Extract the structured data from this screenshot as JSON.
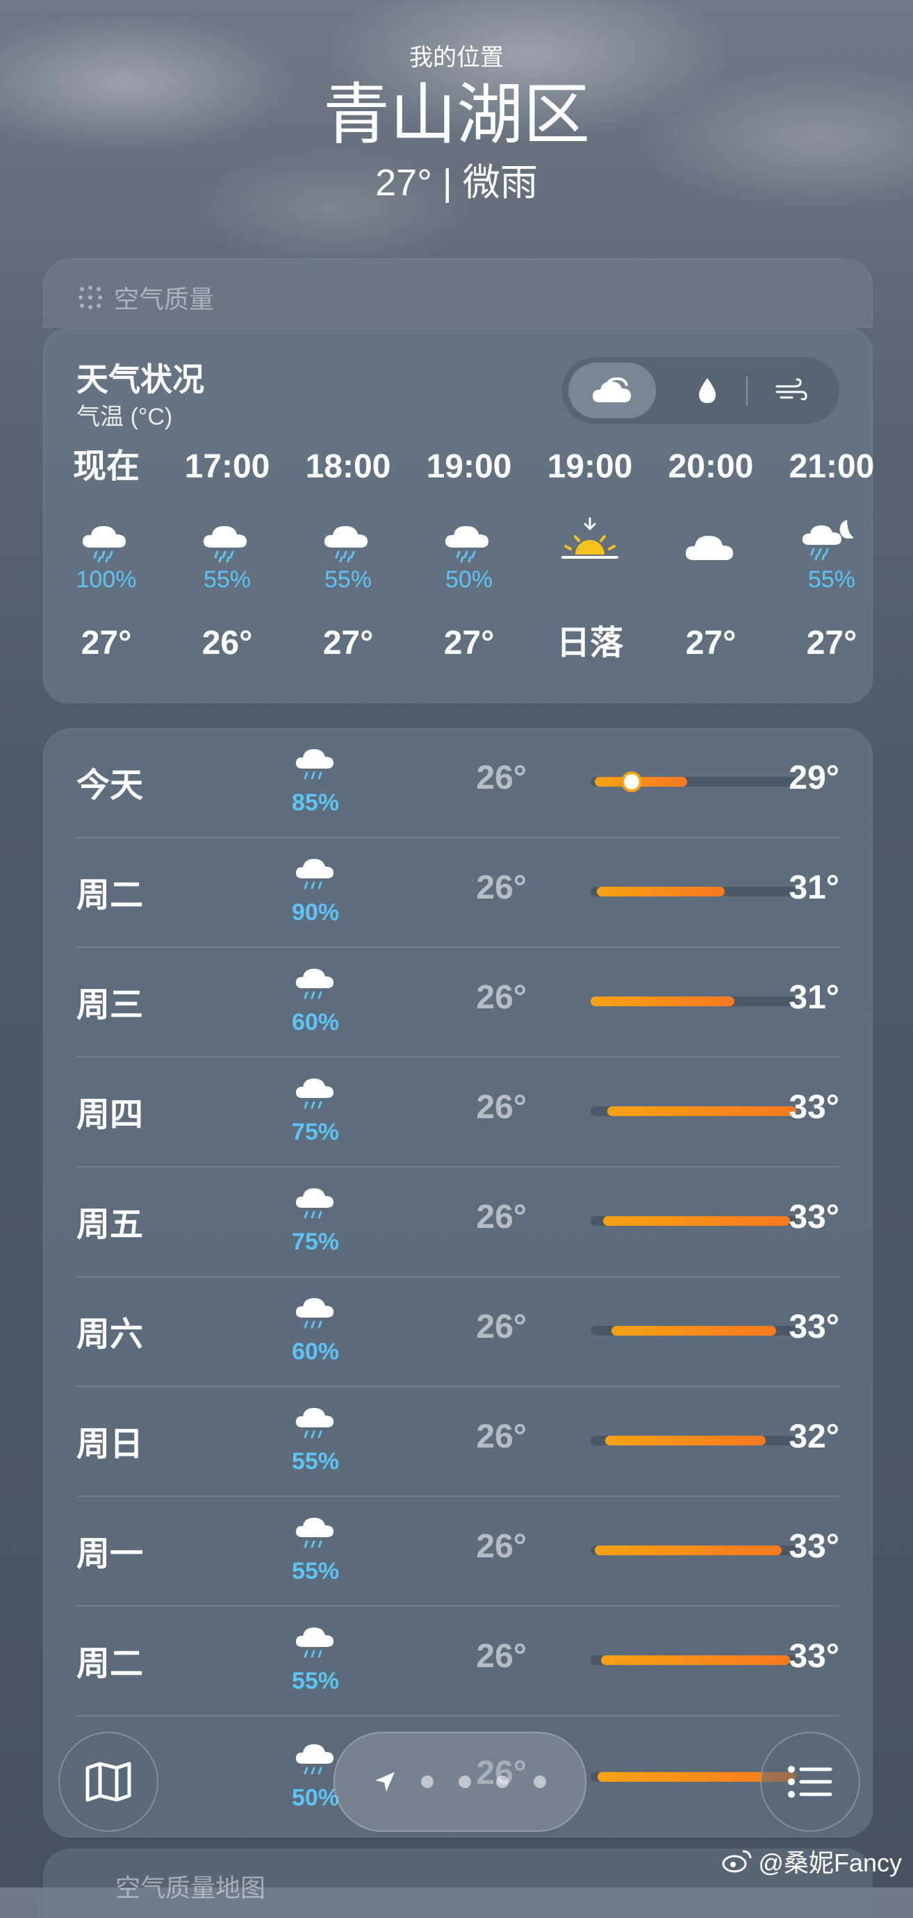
{
  "header": {
    "location_label": "我的位置",
    "city": "青山湖区",
    "summary": "27° | 微雨"
  },
  "aqi": {
    "label": "空气质量"
  },
  "hourly": {
    "title": "天气状况",
    "subtitle": "气温 (°C)",
    "tabs": [
      "cloud-icon",
      "raindrop-icon",
      "wind-icon"
    ],
    "items": [
      {
        "time": "现在",
        "icon": "cloud-rain-icon",
        "pct": "100%",
        "temp": "27°"
      },
      {
        "time": "17:00",
        "icon": "cloud-rain-icon",
        "pct": "55%",
        "temp": "26°"
      },
      {
        "time": "18:00",
        "icon": "cloud-rain-icon",
        "pct": "55%",
        "temp": "27°"
      },
      {
        "time": "19:00",
        "icon": "cloud-rain-icon",
        "pct": "50%",
        "temp": "27°"
      },
      {
        "time": "19:00",
        "icon": "sunset-icon",
        "pct": "",
        "temp": "日落"
      },
      {
        "time": "20:00",
        "icon": "cloud-icon",
        "pct": "",
        "temp": "27°"
      },
      {
        "time": "21:00",
        "icon": "cloud-moon-rain-icon",
        "pct": "55%",
        "temp": "27°"
      }
    ]
  },
  "daily": {
    "items": [
      {
        "day": "今天",
        "pct": "85%",
        "low": "26°",
        "high": "29°",
        "range_start": 0.02,
        "range_end": 0.47,
        "now": 0.2
      },
      {
        "day": "周二",
        "pct": "90%",
        "low": "26°",
        "high": "31°",
        "range_start": 0.03,
        "range_end": 0.65
      },
      {
        "day": "周三",
        "pct": "60%",
        "low": "26°",
        "high": "31°",
        "range_start": 0.0,
        "range_end": 0.7
      },
      {
        "day": "周四",
        "pct": "75%",
        "low": "26°",
        "high": "33°",
        "range_start": 0.08,
        "range_end": 1.0
      },
      {
        "day": "周五",
        "pct": "75%",
        "low": "26°",
        "high": "33°",
        "range_start": 0.06,
        "range_end": 0.97
      },
      {
        "day": "周六",
        "pct": "60%",
        "low": "26°",
        "high": "33°",
        "range_start": 0.1,
        "range_end": 0.9
      },
      {
        "day": "周日",
        "pct": "55%",
        "low": "26°",
        "high": "32°",
        "range_start": 0.07,
        "range_end": 0.85
      },
      {
        "day": "周一",
        "pct": "55%",
        "low": "26°",
        "high": "33°",
        "range_start": 0.02,
        "range_end": 0.93
      },
      {
        "day": "周二",
        "pct": "55%",
        "low": "26°",
        "high": "33°",
        "range_start": 0.05,
        "range_end": 0.97
      }
    ],
    "partial": {
      "pct": "50%",
      "low": "26°"
    }
  },
  "aqi_map": {
    "label": "空气质量地图"
  },
  "watermark": "@桑妮Fancy"
}
